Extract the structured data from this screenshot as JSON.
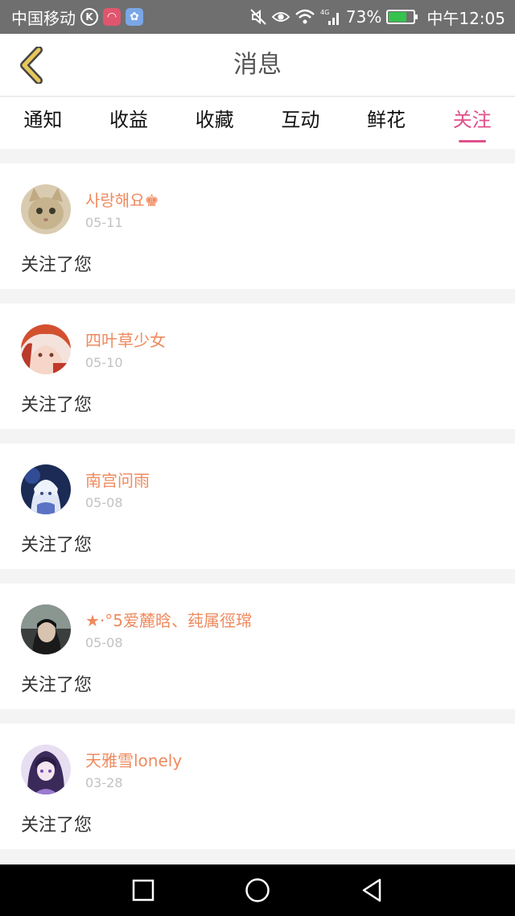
{
  "status_bar": {
    "carrier": "中国移动",
    "k_badge": "K",
    "battery_percent": "73%",
    "battery_level": 0.73,
    "time": "中午12:05",
    "network": "4G",
    "icons": [
      "k-circle-icon",
      "red-app-icon",
      "paw-app-icon",
      "mute-icon",
      "eye-icon",
      "wifi-icon",
      "signal-icon",
      "battery-icon"
    ]
  },
  "header": {
    "title": "消息",
    "back_icon": "chevron-left-icon"
  },
  "tabs": [
    {
      "label": "通知",
      "active": false
    },
    {
      "label": "收益",
      "active": false
    },
    {
      "label": "收藏",
      "active": false
    },
    {
      "label": "互动",
      "active": false
    },
    {
      "label": "鲜花",
      "active": false
    },
    {
      "label": "关注",
      "active": true
    }
  ],
  "messages": [
    {
      "name": "사랑해요♚",
      "date": "05-11",
      "text": "关注了您"
    },
    {
      "name": "四叶草少女",
      "date": "05-10",
      "text": "关注了您"
    },
    {
      "name": "南宫问雨",
      "date": "05-08",
      "text": "关注了您"
    },
    {
      "name": "★·°5爱麓晗、莼属徑瑺",
      "date": "05-08",
      "text": "关注了您"
    },
    {
      "name": "天雅雪lonely",
      "date": "03-28",
      "text": "关注了您"
    }
  ],
  "colors": {
    "accent": "#e0508a",
    "username": "#ef8a5e",
    "date": "#c2c2c2",
    "status_bar": "#6f6f6f",
    "back_arrow": "#e8c75a"
  },
  "nav_bar": {
    "icons": [
      "recent-apps-icon",
      "home-icon",
      "back-icon"
    ]
  }
}
